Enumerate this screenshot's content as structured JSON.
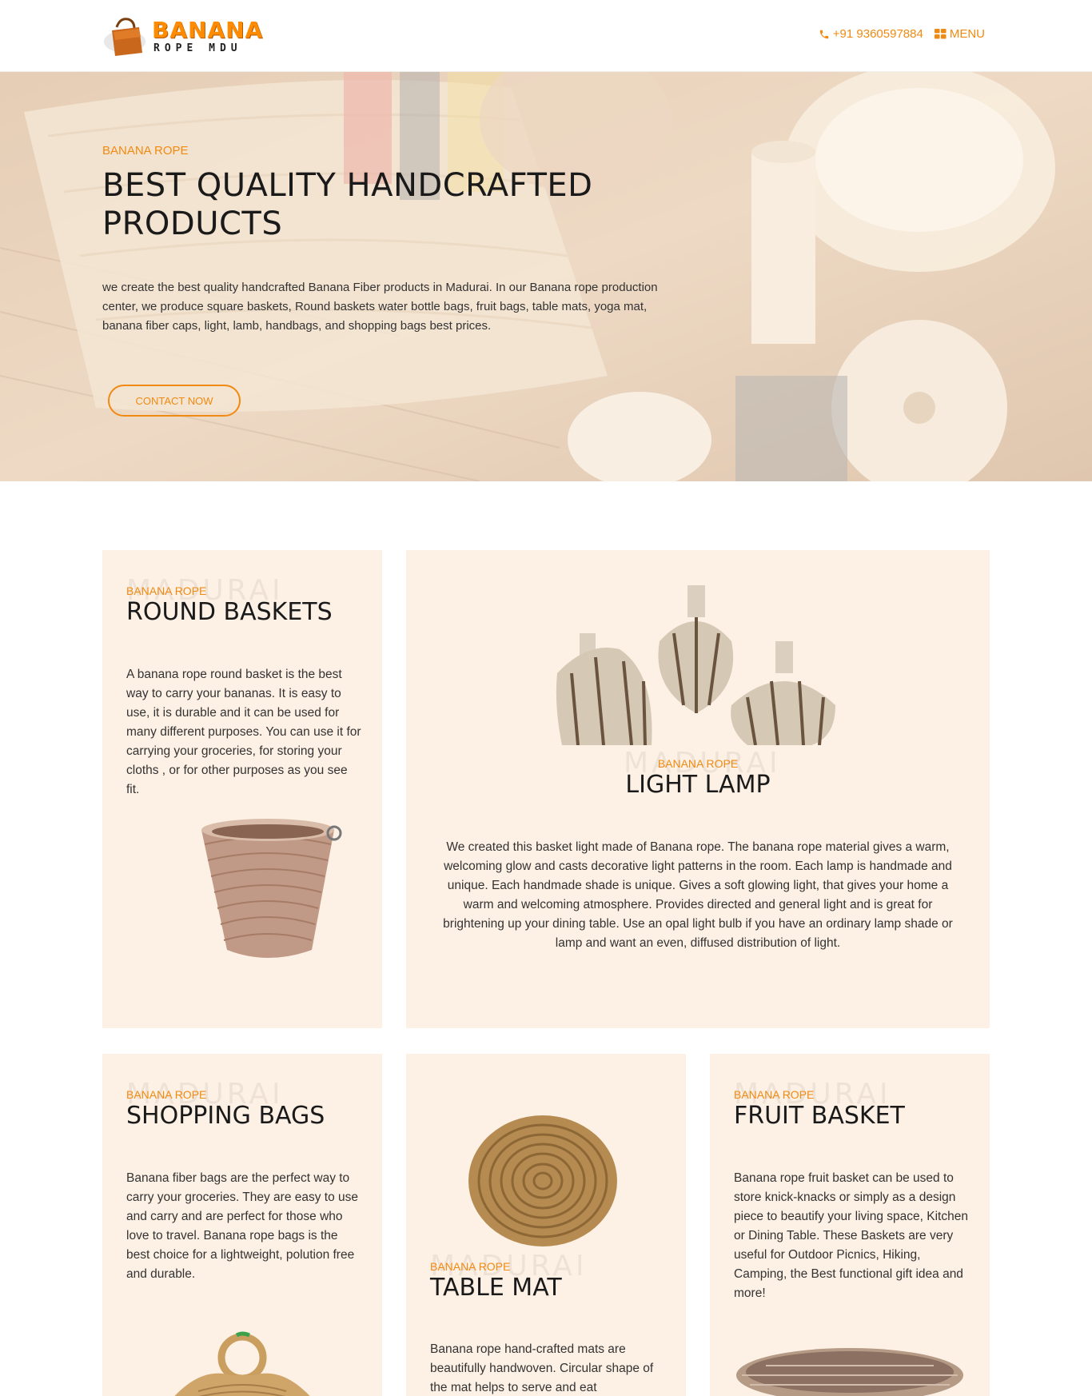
{
  "header": {
    "logo_line1": "BANANA",
    "logo_line2": "ROPE MDU",
    "phone": "+91 9360597884",
    "menu_label": "MENU",
    "phone_icon": "phone-icon",
    "menu_icon": "grid-menu-icon"
  },
  "hero": {
    "eyebrow": "BANANA ROPE",
    "title": "BEST QUALITY HANDCRAFTED PRODUCTS",
    "description": "we create the best quality handcrafted Banana Fiber products in Madurai. In our Banana rope production center, we produce square baskets, Round baskets water bottle bags, fruit bags, table mats, yoga mat, banana fiber caps, light, lamb, handbags, and shopping bags best prices.",
    "button": "CONTACT NOW"
  },
  "cards": [
    {
      "watermark": "MADURAI",
      "eyebrow": "BANANA ROPE",
      "title": "ROUND BASKETS",
      "description": "A banana rope round basket is the best way to carry your bananas. It is easy to use, it is durable and it can be used for many different purposes. You can use it for carrying your groceries, for storing your cloths , or for other purposes as you see fit."
    },
    {
      "watermark": "MADURAI",
      "eyebrow": "BANANA ROPE",
      "title": "LIGHT LAMP",
      "description": "We created this basket light made of Banana rope. The banana rope material gives a warm, welcoming glow and casts decorative light patterns in the room. Each lamp is handmade and unique. Each handmade shade is unique. Gives a soft glowing light, that gives your home a warm and welcoming atmosphere. Provides directed and general light and is great for brightening up your dining table. Use an opal light bulb if you have an ordinary lamp shade or lamp and want an even, diffused distribution of light."
    },
    {
      "watermark": "MADURAI",
      "eyebrow": "BANANA ROPE",
      "title": "SHOPPING BAGS",
      "description": "Banana fiber bags are the perfect way to carry your groceries. They are easy to use and carry and are perfect for those who love to travel. Banana rope bags is the best choice for a lightweight, polution free and durable."
    },
    {
      "watermark": "MADURAI",
      "eyebrow": "BANANA ROPE",
      "title": "TABLE MAT",
      "description": "Banana rope hand-crafted mats are beautifully handwoven. Circular shape of the mat helps to serve and eat"
    },
    {
      "watermark": "MADURAI",
      "eyebrow": "BANANA ROPE",
      "title": "FRUIT BASKET",
      "description": "Banana rope fruit basket can be used to store knick-knacks or simply as a design piece to beautify your living space, Kitchen or Dining Table. These Baskets are very useful for Outdoor Picnics, Hiking, Camping, the Best functional gift idea and more!"
    }
  ],
  "colors": {
    "accent": "#f08a12",
    "card_bg": "#fdf0e4"
  }
}
